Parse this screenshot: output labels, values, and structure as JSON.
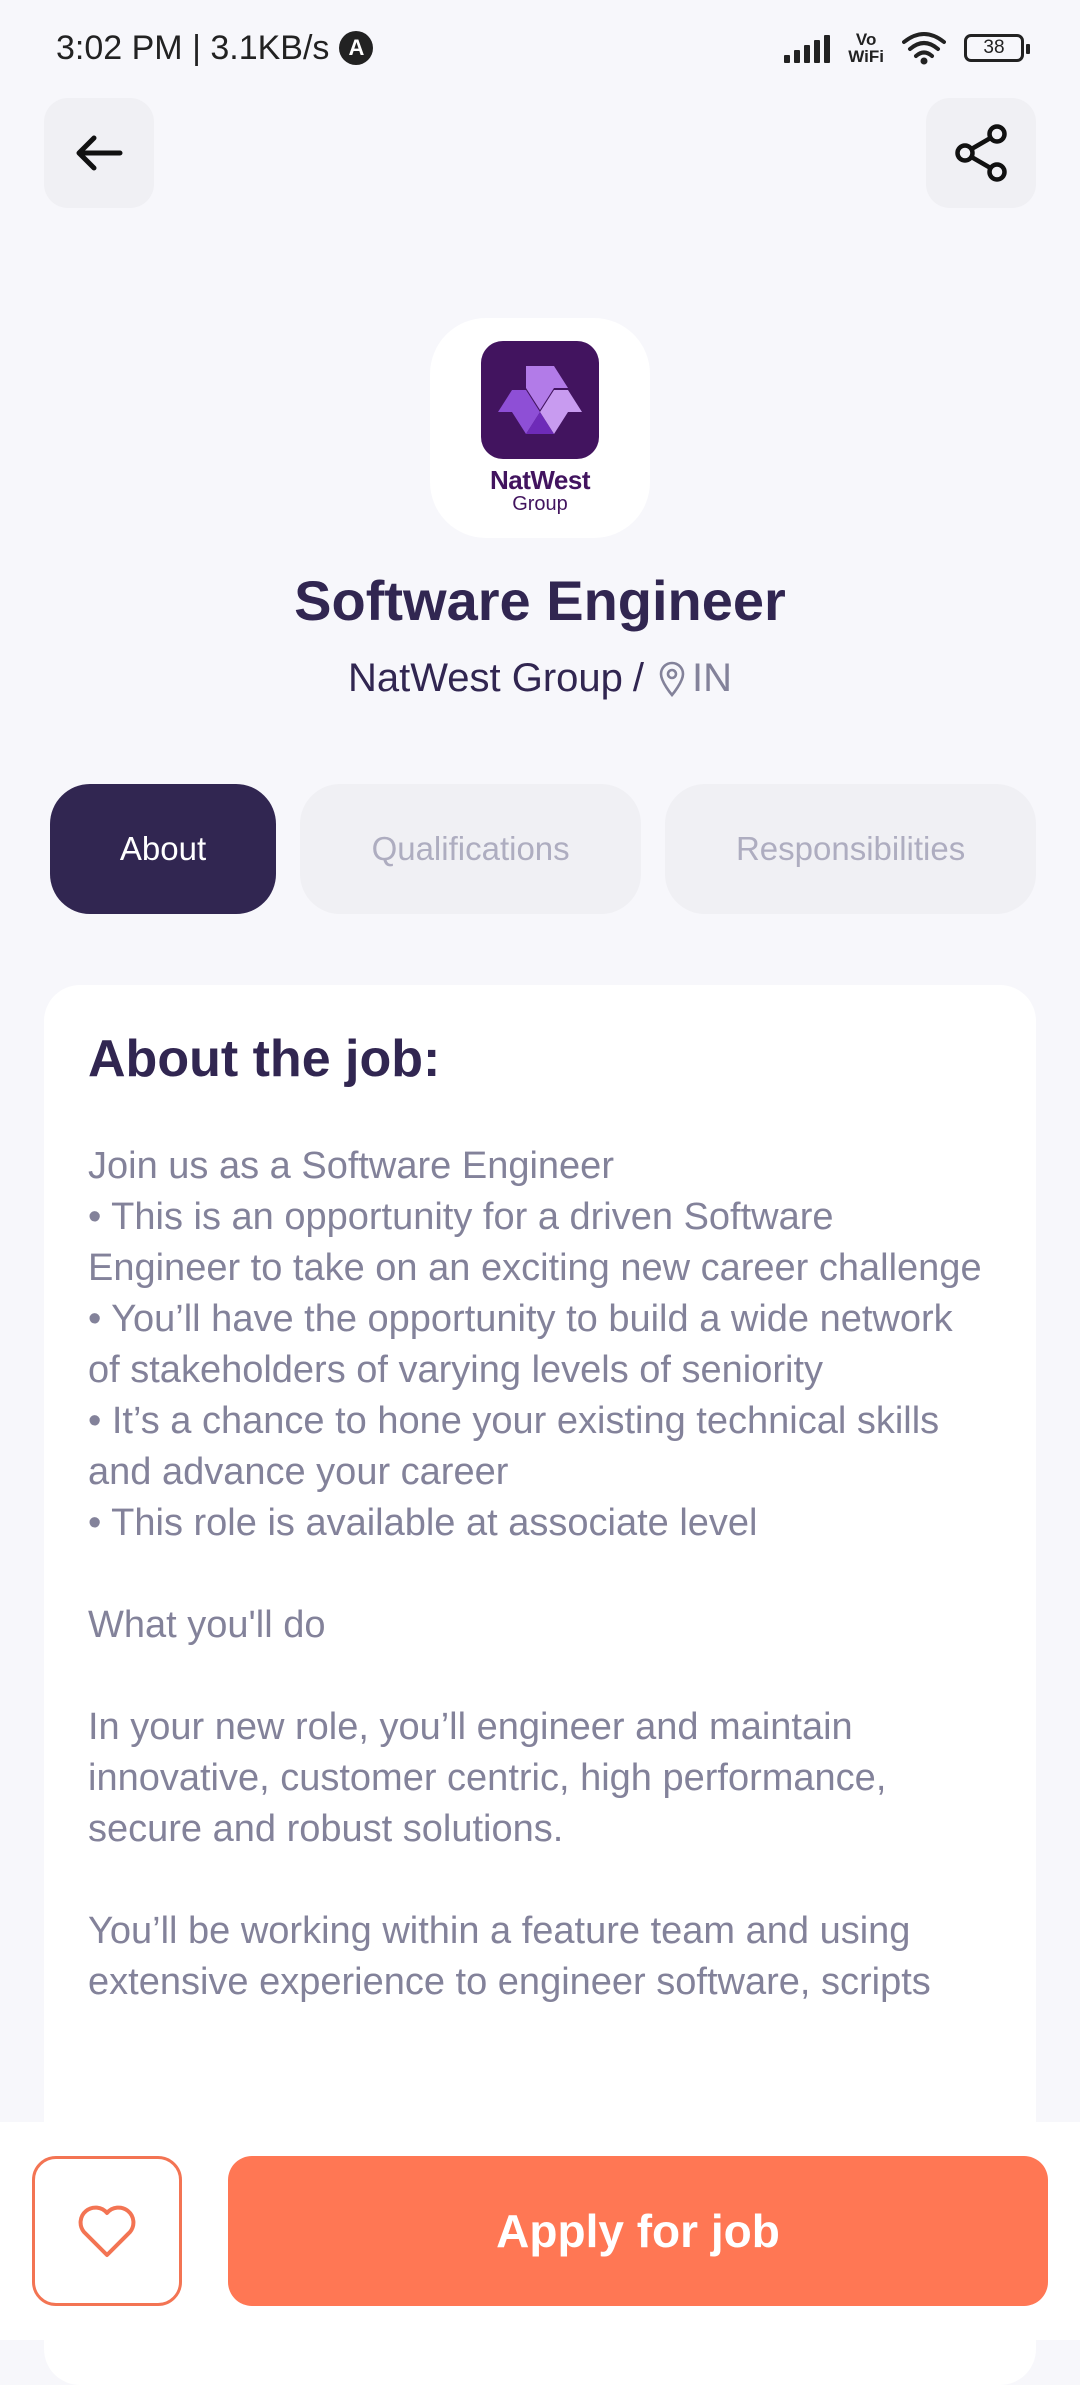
{
  "status_bar": {
    "time_speed": "3:02 PM | 3.1KB/s",
    "app_badge": "A",
    "vowifi_top": "Vo",
    "vowifi_bottom": "WiFi",
    "battery": "38"
  },
  "header": {
    "back_icon": "arrow-left-icon",
    "share_icon": "share-icon"
  },
  "company": {
    "logo_name": "NatWest",
    "logo_sub": "Group",
    "brand_color": "#42145f"
  },
  "job": {
    "title": "Software Engineer",
    "company": "NatWest Group",
    "separator": "/",
    "location": "IN"
  },
  "tabs": [
    {
      "label": "About",
      "active": true
    },
    {
      "label": "Qualifications",
      "active": false
    },
    {
      "label": "Responsibilities",
      "active": false
    }
  ],
  "about": {
    "heading": "About the job:",
    "text": "Join us as a Software Engineer\n• This is an opportunity for a driven Software Engineer to take on an exciting new career challenge\n• You’ll have the opportunity to build a wide network of stakeholders of varying levels of seniority\n• It’s a chance to hone your existing technical skills and advance your career\n• This role is available at associate level\n\nWhat you'll do\n\nIn your new role, you’ll engineer and maintain innovative, customer centric, high performance, secure and robust solutions.\n\nYou’ll be working within a feature team and using extensive experience to engineer software, scripts"
  },
  "footer": {
    "like_icon": "heart-outline-icon",
    "apply_label": "Apply for job",
    "accent_color": "#ff7754"
  },
  "colors": {
    "primary": "#312651",
    "gray": "#83829a",
    "tab_bg": "#f0f0f4",
    "background": "#f7f7fb"
  }
}
